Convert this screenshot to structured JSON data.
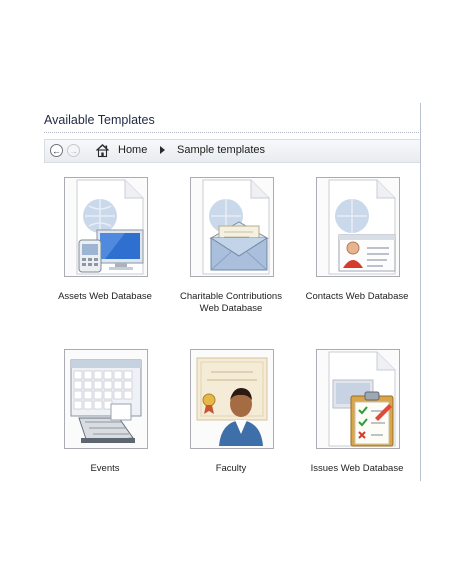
{
  "panel": {
    "title": "Available Templates"
  },
  "nav": {
    "back_icon": "back-arrow-icon",
    "forward_icon": "forward-arrow-icon",
    "home_icon": "home-icon",
    "breadcrumb": [
      "Home",
      "Sample templates"
    ]
  },
  "templates": [
    {
      "label": "Assets Web Database",
      "icon": "assets-template-icon"
    },
    {
      "label": "Charitable Contributions Web Database",
      "icon": "envelope-template-icon"
    },
    {
      "label": "Contacts Web Database",
      "icon": "contact-card-template-icon"
    },
    {
      "label": "Events",
      "icon": "calendar-template-icon"
    },
    {
      "label": "Faculty",
      "icon": "faculty-template-icon"
    },
    {
      "label": "Issues Web Database",
      "icon": "clipboard-template-icon"
    }
  ]
}
